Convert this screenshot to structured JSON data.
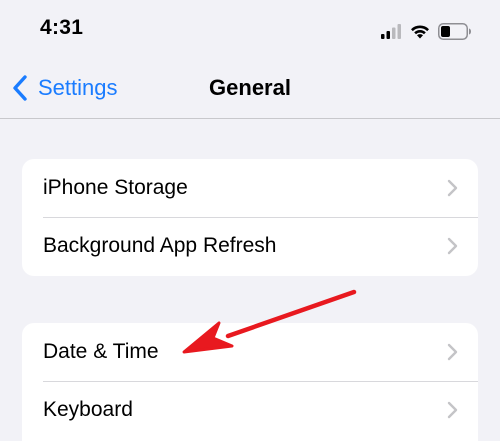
{
  "status_bar": {
    "time": "4:31",
    "icons": [
      "cellular-signal-icon",
      "wifi-icon",
      "battery-icon"
    ]
  },
  "nav": {
    "back_label": "Settings",
    "title": "General"
  },
  "groups": [
    {
      "items": [
        {
          "label": "iPhone Storage"
        },
        {
          "label": "Background App Refresh"
        }
      ]
    },
    {
      "items": [
        {
          "label": "Date & Time"
        },
        {
          "label": "Keyboard"
        }
      ]
    }
  ],
  "colors": {
    "accent": "#1a7cff",
    "background": "#f2f2f7",
    "annotation": "#e8191f"
  }
}
